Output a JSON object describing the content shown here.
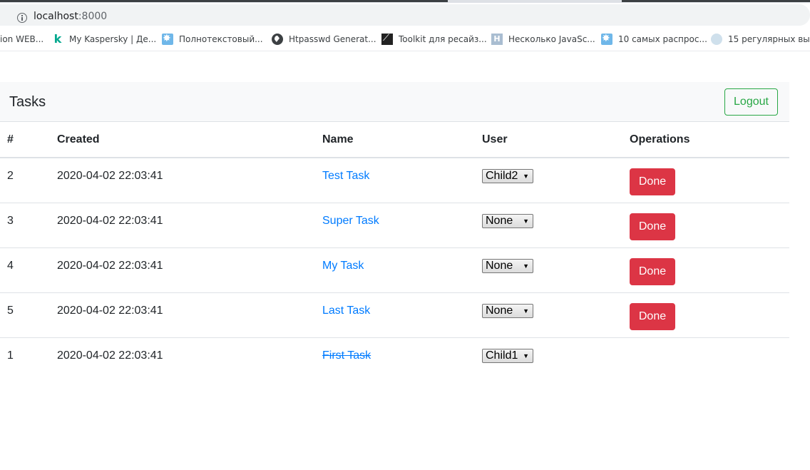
{
  "browser": {
    "url_host": "localhost",
    "url_port": ":8000",
    "bookmarks": [
      {
        "label": "ion WEB...",
        "icon": "none"
      },
      {
        "label": "My Kaspersky | Де...",
        "icon": "kaspersky-icon"
      },
      {
        "label": "Полнотекстовый...",
        "icon": "star-badge-icon"
      },
      {
        "label": "Htpasswd Generat...",
        "icon": "globe-icon"
      },
      {
        "label": "Toolkit для ресайз...",
        "icon": "toolkit-icon"
      },
      {
        "label": "Несколько JavaSc...",
        "icon": "h-icon"
      },
      {
        "label": "10 самых распрос...",
        "icon": "star-badge-icon"
      },
      {
        "label": "15 регулярных вы...",
        "icon": "bubble-icon"
      }
    ]
  },
  "navbar": {
    "title": "Tasks",
    "logout_label": "Logout"
  },
  "table": {
    "headers": {
      "id": "#",
      "created": "Created",
      "name": "Name",
      "user": "User",
      "operations": "Operations"
    },
    "rows": [
      {
        "id": "2",
        "created": "2020-04-02 22:03:41",
        "name": "Test Task",
        "user": "Child2",
        "done": false,
        "action": "Done"
      },
      {
        "id": "3",
        "created": "2020-04-02 22:03:41",
        "name": "Super Task",
        "user": "None",
        "done": false,
        "action": "Done"
      },
      {
        "id": "4",
        "created": "2020-04-02 22:03:41",
        "name": "My Task",
        "user": "None",
        "done": false,
        "action": "Done"
      },
      {
        "id": "5",
        "created": "2020-04-02 22:03:41",
        "name": "Last Task",
        "user": "None",
        "done": false,
        "action": "Done"
      },
      {
        "id": "1",
        "created": "2020-04-02 22:03:41",
        "name": "First Task",
        "user": "Child1",
        "done": true,
        "action": ""
      }
    ]
  },
  "colors": {
    "link": "#007bff",
    "danger": "#dc3545",
    "success": "#28a745"
  }
}
